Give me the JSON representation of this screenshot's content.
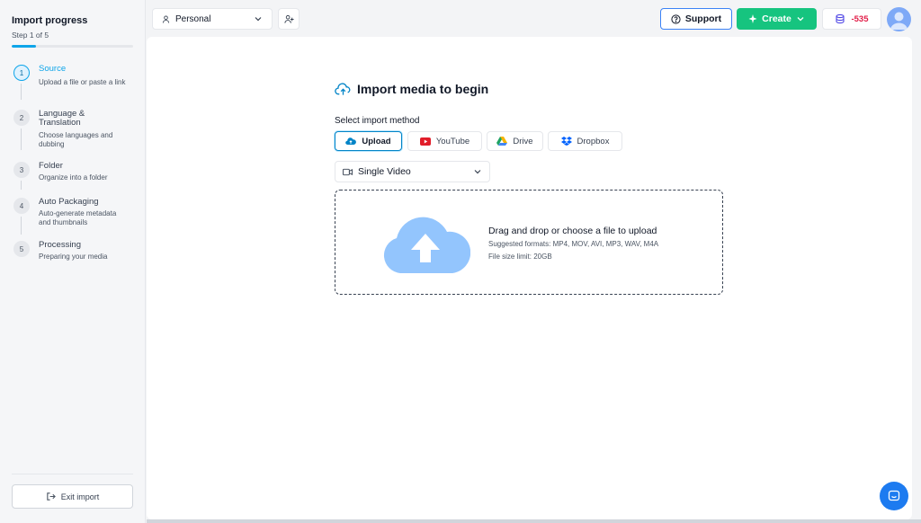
{
  "sidebar": {
    "title": "Import progress",
    "step_indicator": "Step 1 of 5",
    "progress_fraction": 0.2,
    "steps": [
      {
        "num": "1",
        "title": "Source",
        "desc": "Upload a file or paste a link"
      },
      {
        "num": "2",
        "title": "Language & Translation",
        "desc": "Choose languages and dubbing"
      },
      {
        "num": "3",
        "title": "Folder",
        "desc": "Organize into a folder"
      },
      {
        "num": "4",
        "title": "Auto Packaging",
        "desc": "Auto-generate metadata and thumbnails"
      },
      {
        "num": "5",
        "title": "Processing",
        "desc": "Preparing your media"
      }
    ],
    "exit_label": "Exit import"
  },
  "header": {
    "workspace_label": "Personal",
    "support_label": "Support",
    "create_label": "Create",
    "credits": "-535"
  },
  "main": {
    "title": "Import media to begin",
    "method_label": "Select import method",
    "methods": [
      {
        "label": "Upload",
        "icon": "cloud-upload-icon",
        "selected": true
      },
      {
        "label": "YouTube",
        "icon": "youtube-icon",
        "selected": false
      },
      {
        "label": "Drive",
        "icon": "google-drive-icon",
        "selected": false
      },
      {
        "label": "Dropbox",
        "icon": "dropbox-icon",
        "selected": false
      }
    ],
    "type_select": "Single Video",
    "dropzone": {
      "title": "Drag and drop or choose a file to upload",
      "formats": "Suggested formats: MP4, MOV, AVI, MP3, WAV, M4A",
      "limit": "File size limit: 20GB"
    }
  },
  "colors": {
    "accent": "#0ea5e9",
    "create_green": "#16c47f",
    "credit_red": "#e11d48",
    "cloud_blue": "#93c5fd",
    "chat_blue": "#1d7bf0"
  }
}
